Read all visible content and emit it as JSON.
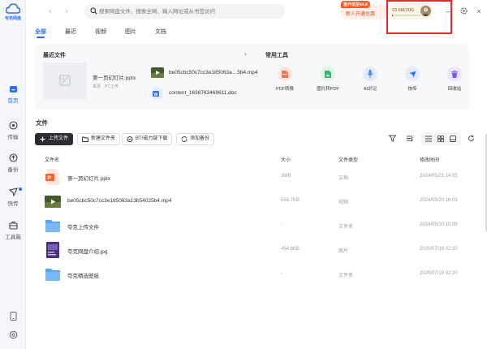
{
  "app": {
    "logo_text": "夸克网盘"
  },
  "rail": {
    "items": [
      {
        "label": "首页",
        "icon": "home-icon",
        "active": true
      },
      {
        "label": "传输",
        "icon": "transfer-icon",
        "active": false
      },
      {
        "label": "备份",
        "icon": "backup-icon",
        "active": false
      },
      {
        "label": "快传",
        "icon": "quick-send-icon",
        "active": false
      },
      {
        "label": "工具箱",
        "icon": "toolbox-icon",
        "active": false
      }
    ],
    "bottom": [
      {
        "icon": "phone-icon"
      },
      {
        "icon": "settings-icon"
      }
    ]
  },
  "topbar": {
    "search_placeholder": "搜索网盘文件、搜索全网、输入网址或从书签访问",
    "promo_tag": "首开低至¥4.8",
    "promo_text": "新人开通优惠",
    "storage_text": "23.6M/20G",
    "storage_fraction": 0.00115
  },
  "tabs": [
    {
      "label": "全部",
      "active": true
    },
    {
      "label": "最近",
      "active": false
    },
    {
      "label": "视频",
      "active": false
    },
    {
      "label": "图片",
      "active": false
    },
    {
      "label": "文档",
      "active": false
    }
  ],
  "recent": {
    "title": "最近文件",
    "featured": {
      "name": "第一页幻灯片.pptx",
      "sub1": "来源",
      "sub2": "PC上传"
    },
    "items": [
      {
        "name": "be05cbc50c7cc3e185063a…5b4.mp4",
        "type": "video"
      },
      {
        "name": "content_1638763469611.doc",
        "type": "doc"
      }
    ]
  },
  "tools": {
    "title": "常用工具",
    "items": [
      {
        "label": "PDF转换",
        "color": "#f2765a",
        "bg": "#fde6df",
        "icon": "pdf-icon"
      },
      {
        "label": "图片转PDF",
        "color": "#3bb06f",
        "bg": "#dff3e6",
        "icon": "image-to-pdf-icon"
      },
      {
        "label": "AI识记",
        "color": "#3d7ff2",
        "bg": "#e1ebfd",
        "icon": "ai-note-icon"
      },
      {
        "label": "快传",
        "color": "#2f6ef5",
        "bg": "#e3ecfe",
        "icon": "quick-send-icon"
      },
      {
        "label": "回收站",
        "color": "#7a5cf0",
        "bg": "#ebe6fd",
        "icon": "recycle-bin-icon"
      }
    ]
  },
  "files": {
    "title": "文件",
    "buttons": {
      "upload": "上传文件",
      "new_folder": "新建文件夹",
      "bt": "BT/磁力链下载",
      "backup": "添加备份"
    },
    "columns": {
      "name": "文件名",
      "size": "大小",
      "type": "文件类型",
      "time": "修改时间"
    },
    "rows": [
      {
        "name": "第一页幻灯片.pptx",
        "size": "3MB",
        "type": "文档",
        "time": "2024/05/21 14:05",
        "kind": "pptx"
      },
      {
        "name": "be05cbc50c7cc3e185063a13b54025b4.mp4",
        "size": "556.7KB",
        "type": "视频",
        "time": "2024/05/20 16:03",
        "kind": "video"
      },
      {
        "name": "夸克上传文件",
        "size": "-",
        "type": "文件夹",
        "time": "2024/05/20 10:39",
        "kind": "folder"
      },
      {
        "name": "夸克网盘介绍.jpg",
        "size": "454.6KB",
        "type": "图片",
        "time": "2020/07/19 02:20",
        "kind": "image"
      },
      {
        "name": "夸克精选壁纸",
        "size": "-",
        "type": "文件夹",
        "time": "2020/07/19 02:20",
        "kind": "folder"
      }
    ]
  }
}
